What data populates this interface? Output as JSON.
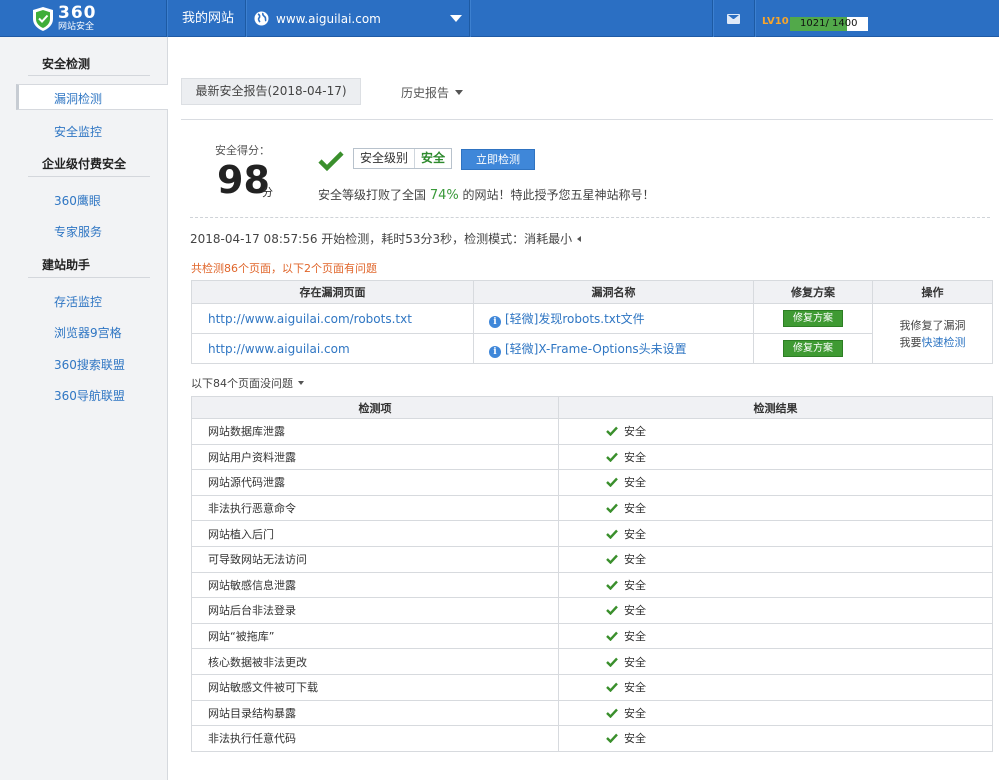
{
  "header": {
    "logo_big": "360",
    "logo_small": "网站安全",
    "my_site": "我的网站",
    "site_domain": "www.aiguilai.com",
    "level": "LV10",
    "xp_text": "1021/ 1400",
    "xp_progress": 0.73
  },
  "sidebar": {
    "sections": [
      {
        "title": "安全检测",
        "items": [
          "漏洞检测",
          "安全监控"
        ]
      },
      {
        "title": "企业级付费安全",
        "items": [
          "360鹰眼",
          "专家服务"
        ]
      },
      {
        "title": "建站助手",
        "items": [
          "存活监控",
          "浏览器9宫格",
          "360搜索联盟",
          "360导航联盟"
        ]
      }
    ],
    "active_item": "漏洞检测"
  },
  "tabs": {
    "latest_report": "最新安全报告(2018-04-17)",
    "history_report": "历史报告"
  },
  "summary": {
    "score_label": "安全得分：",
    "score": "98",
    "score_unit": "分",
    "level_key": "安全级别",
    "level_value": "安全",
    "detect_button": "立即检测",
    "rank_prefix": "安全等级打败了全国 ",
    "rank_pct": "74%",
    "rank_suffix": " 的网站！特此授予您五星神站称号！"
  },
  "scan": {
    "info": "2018-04-17 08:57:56 开始检测，耗时53分3秒，检测模式：消耗最小",
    "found": "共检测86个页面，以下2个页面有问题"
  },
  "vuln_table": {
    "headers": [
      "存在漏洞页面",
      "漏洞名称",
      "修复方案",
      "操作"
    ],
    "rows": [
      {
        "url": "http://www.aiguilai.com/robots.txt",
        "name": "[轻微]发现robots.txt文件",
        "fix": "修复方案"
      },
      {
        "url": "http://www.aiguilai.com",
        "name": "[轻微]X-Frame-Options头未设置",
        "fix": "修复方案"
      }
    ],
    "op_line1": "我修复了漏洞",
    "op_line2_prefix": "我要",
    "op_line2_link": "快速检测"
  },
  "nonproblem_label": "以下84个页面没问题",
  "check_table": {
    "headers": [
      "检测项",
      "检测结果"
    ],
    "result": "安全",
    "items": [
      "网站数据库泄露",
      "网站用户资料泄露",
      "网站源代码泄露",
      "非法执行恶意命令",
      "网站植入后门",
      "可导致网站无法访问",
      "网站敏感信息泄露",
      "网站后台非法登录",
      "网站“被拖库”",
      "核心数据被非法更改",
      "网站敏感文件被可下载",
      "网站目录结构暴露",
      "非法执行任意代码"
    ]
  },
  "colors": {
    "topbar": "#2b6fc3",
    "link": "#2f76c3",
    "safe_green": "#3a9a3a",
    "warn_orange": "#e0652a",
    "fix_button": "#3f9a33"
  }
}
